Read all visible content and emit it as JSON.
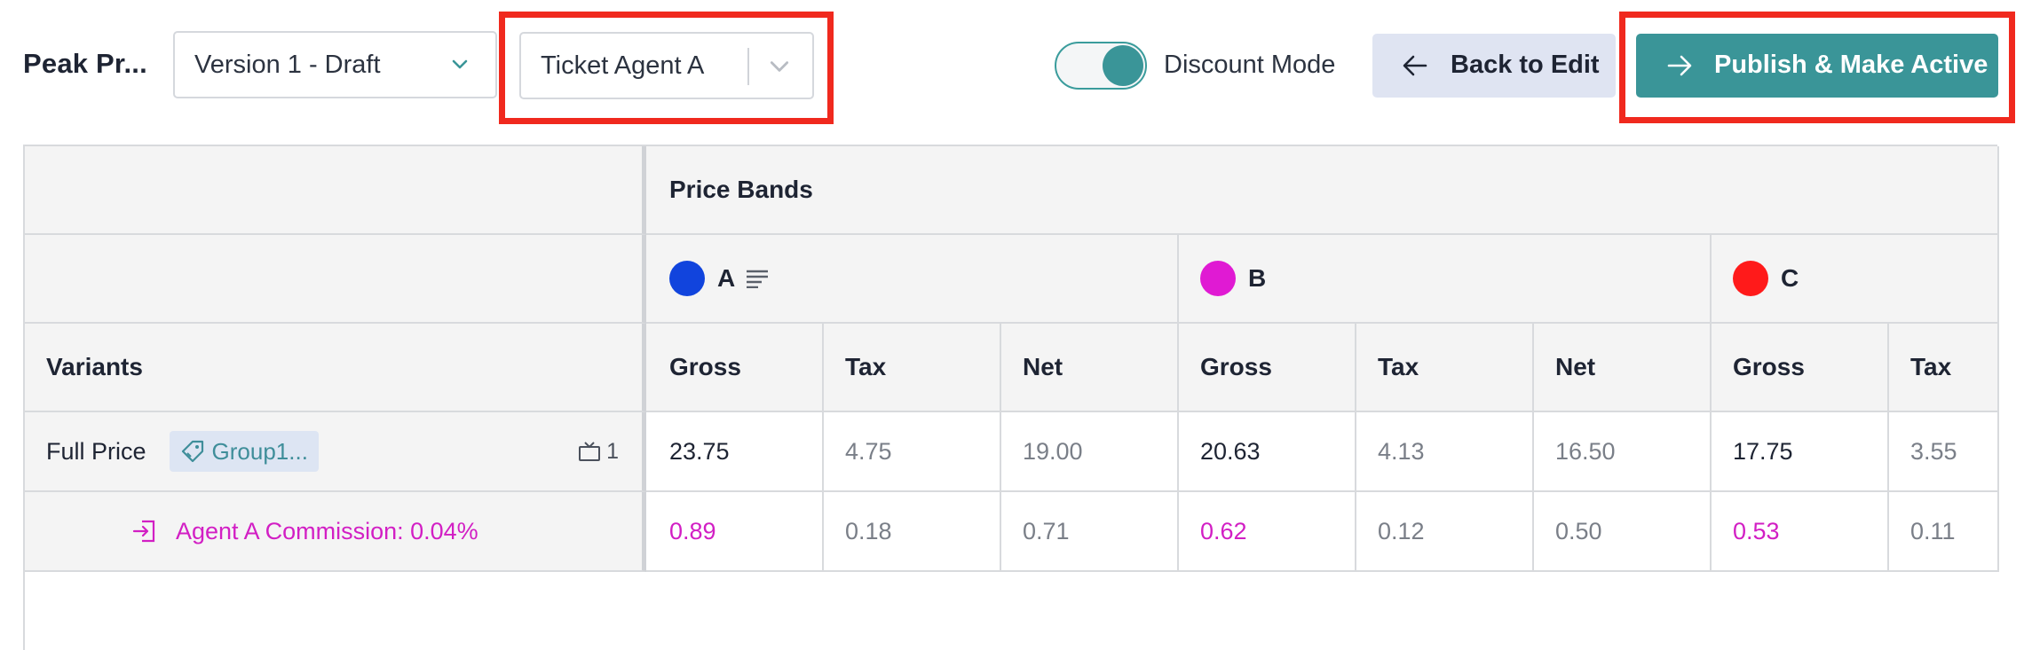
{
  "toolbar": {
    "title": "Peak Pr...",
    "version_select": {
      "value": "Version 1 - Draft"
    },
    "agent_select": {
      "value": "Ticket Agent A"
    },
    "discount_toggle": {
      "label": "Discount Mode",
      "on": true
    },
    "back_button": {
      "label": "Back to Edit"
    },
    "publish_button": {
      "label": "Publish & Make Active"
    }
  },
  "colors": {
    "accent": "#3a9598",
    "highlight": "#f0291e",
    "band_a": "#1144dd",
    "band_b": "#e01ad3",
    "band_c": "#ff1a1a",
    "commission": "#d21fc4"
  },
  "table": {
    "price_bands_header": "Price Bands",
    "variants_header": "Variants",
    "bands": [
      {
        "name": "A",
        "color": "#1144dd",
        "has_notes_icon": true
      },
      {
        "name": "B",
        "color": "#e01ad3",
        "has_notes_icon": false
      },
      {
        "name": "C",
        "color": "#ff1a1a",
        "has_notes_icon": false
      }
    ],
    "columns": [
      "Gross",
      "Tax",
      "Net",
      "Gross",
      "Tax",
      "Net",
      "Gross",
      "Tax"
    ],
    "rows": [
      {
        "variant": "Full Price",
        "tag": "Group1...",
        "count": "1",
        "values": [
          "23.75",
          "4.75",
          "19.00",
          "20.63",
          "4.13",
          "16.50",
          "17.75",
          "3.55"
        ]
      },
      {
        "variant": "Agent A Commission: 0.04%",
        "values": [
          "0.89",
          "0.18",
          "0.71",
          "0.62",
          "0.12",
          "0.50",
          "0.53",
          "0.11"
        ]
      }
    ]
  }
}
